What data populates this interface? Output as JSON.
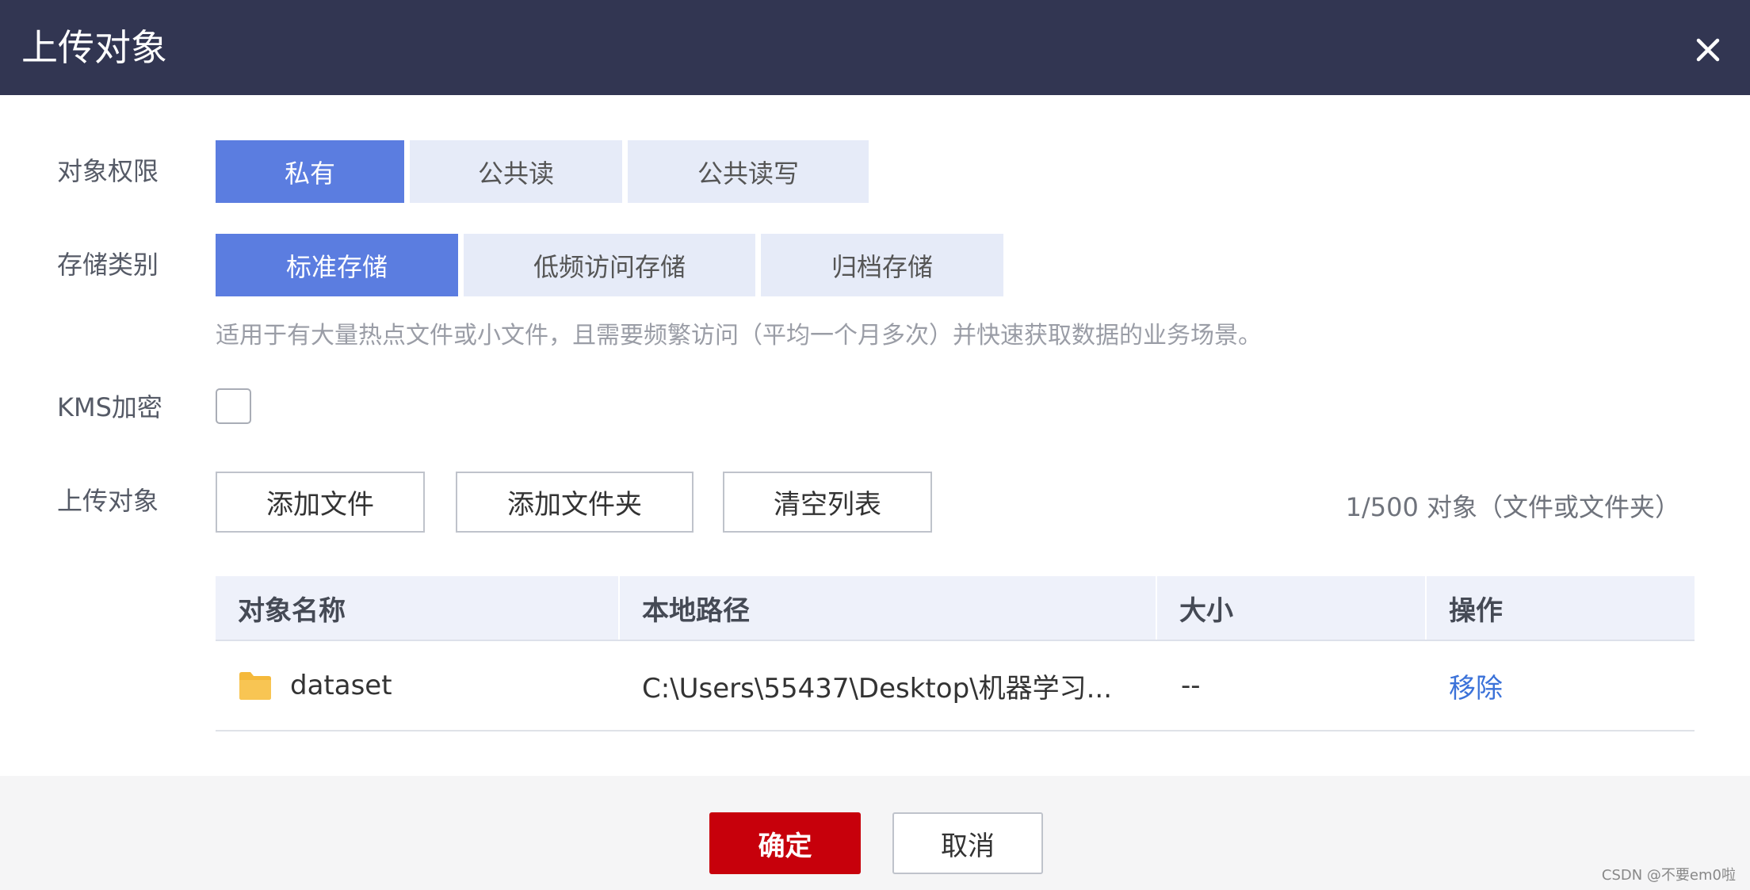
{
  "dialog": {
    "title": "上传对象",
    "close_icon": "close-icon"
  },
  "permission": {
    "label": "对象权限",
    "options": [
      "私有",
      "公共读",
      "公共读写"
    ],
    "selected": "私有"
  },
  "storage_class": {
    "label": "存储类别",
    "options": [
      "标准存储",
      "低频访问存储",
      "归档存储"
    ],
    "selected": "标准存储",
    "description": "适用于有大量热点文件或小文件，且需要频繁访问（平均一个月多次）并快速获取数据的业务场景。"
  },
  "kms": {
    "label": "KMS加密",
    "checked": false
  },
  "upload": {
    "label": "上传对象",
    "add_file": "添加文件",
    "add_folder": "添加文件夹",
    "clear_list": "清空列表",
    "count_text": "1/500 对象（文件或文件夹）"
  },
  "table": {
    "columns": [
      "对象名称",
      "本地路径",
      "大小",
      "操作"
    ],
    "rows": [
      {
        "name": "dataset",
        "icon": "folder-icon",
        "path": "C:\\Users\\55437\\Desktop\\机器学习...",
        "size": "--",
        "action": "移除"
      }
    ]
  },
  "footer": {
    "confirm": "确定",
    "cancel": "取消"
  },
  "watermark": "CSDN @不要em0啦",
  "colors": {
    "header_bg": "#323652",
    "active_segment": "#5b7de0",
    "inactive_segment": "#e6ebf8",
    "confirm_button": "#c7000b",
    "link": "#3b72d9",
    "folder": "#f5b93b"
  }
}
